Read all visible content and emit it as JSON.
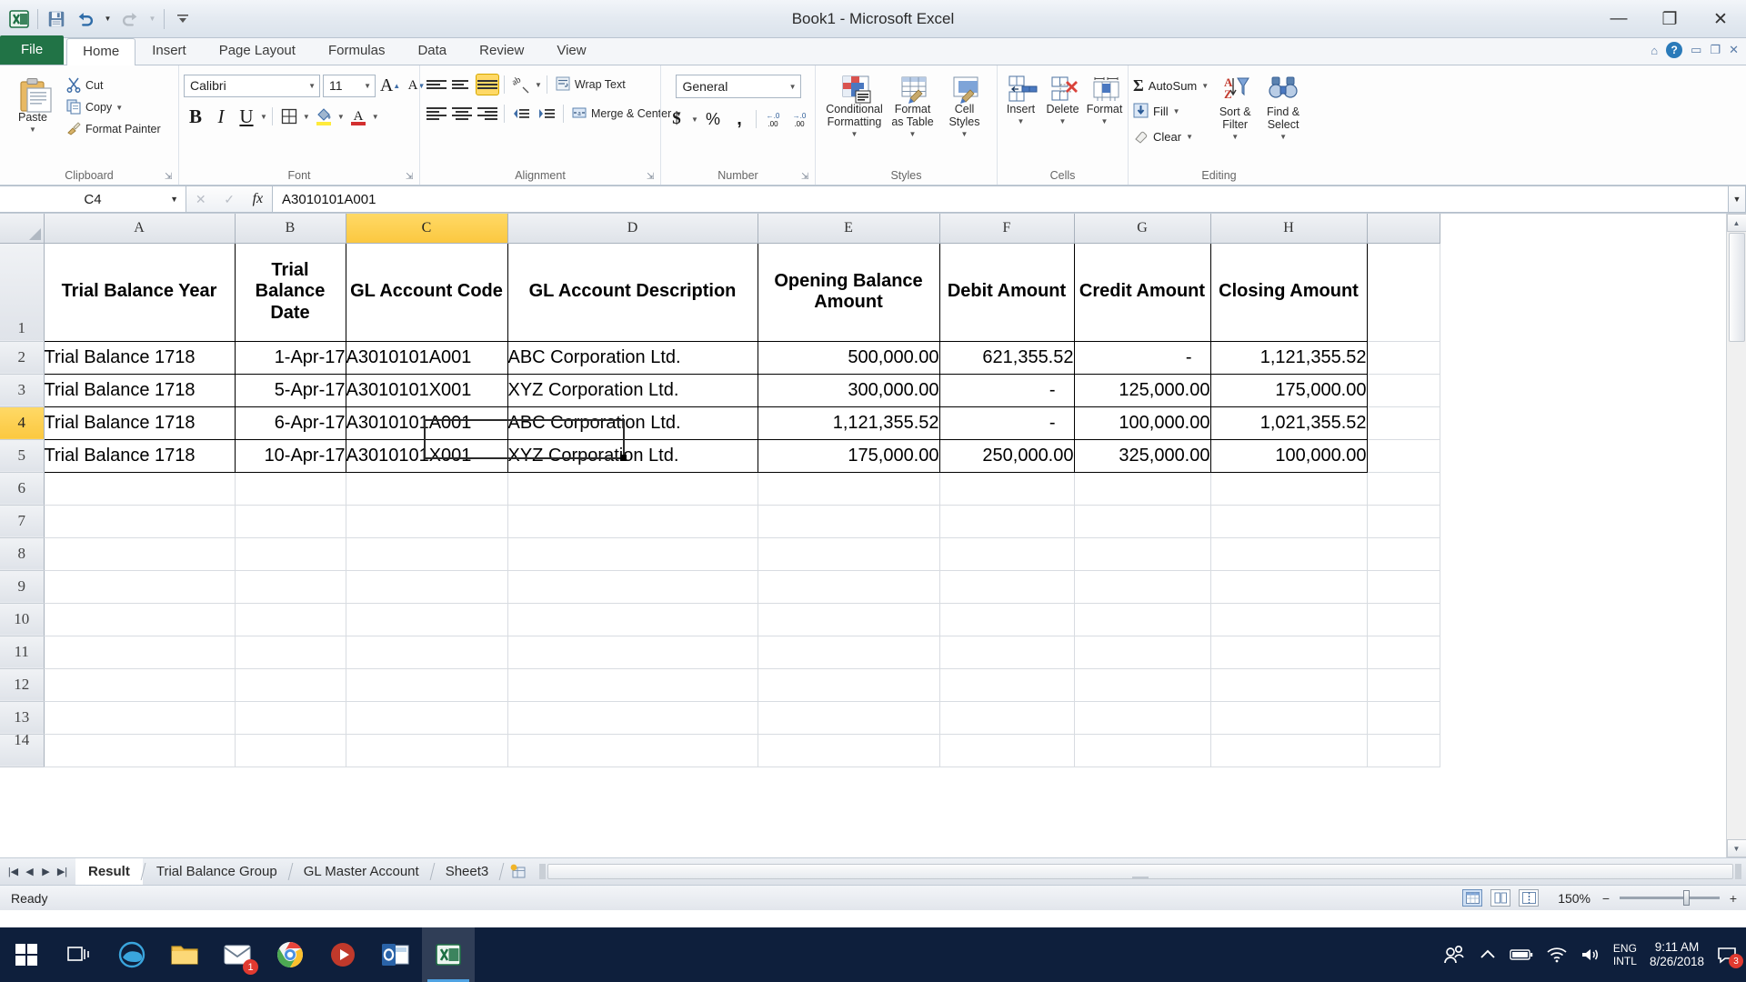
{
  "window": {
    "title": "Book1 - Microsoft Excel",
    "minimize": "—",
    "restore": "❐",
    "close": "✕"
  },
  "qat": {
    "excel_logo": "excel-logo",
    "save": "save-icon",
    "undo": "undo-icon",
    "redo": "redo-icon",
    "customize": "customize-qat-icon"
  },
  "ribbon": {
    "tabs": [
      {
        "label": "File",
        "active": false,
        "file": true
      },
      {
        "label": "Home",
        "active": true
      },
      {
        "label": "Insert",
        "active": false
      },
      {
        "label": "Page Layout",
        "active": false
      },
      {
        "label": "Formulas",
        "active": false
      },
      {
        "label": "Data",
        "active": false
      },
      {
        "label": "Review",
        "active": false
      },
      {
        "label": "View",
        "active": false
      }
    ],
    "groups": {
      "clipboard": {
        "label": "Clipboard",
        "paste": "Paste",
        "cut": "Cut",
        "copy": "Copy",
        "format_painter": "Format Painter"
      },
      "font": {
        "label": "Font",
        "font_name": "Calibri",
        "font_size": "11",
        "grow": "A",
        "shrink": "A",
        "bold": "B",
        "italic": "I",
        "underline": "U",
        "borders": "borders-icon",
        "fill_color": "fill-color-icon",
        "font_color": "A"
      },
      "alignment": {
        "label": "Alignment",
        "wrap_text": "Wrap Text",
        "merge_center": "Merge & Center",
        "orientation": "orientation-icon",
        "decrease_indent": "decrease-indent-icon",
        "increase_indent": "increase-indent-icon"
      },
      "number": {
        "label": "Number",
        "format": "General",
        "currency": "$",
        "percent": "%",
        "comma": ",",
        "increase_decimal": "increase-decimal-icon",
        "decrease_decimal": "decrease-decimal-icon"
      },
      "styles": {
        "label": "Styles",
        "conditional_formatting": "Conditional Formatting",
        "format_as_table": "Format as Table",
        "cell_styles": "Cell Styles"
      },
      "cells": {
        "label": "Cells",
        "insert": "Insert",
        "delete": "Delete",
        "format": "Format"
      },
      "editing": {
        "label": "Editing",
        "autosum": "AutoSum",
        "fill": "Fill",
        "clear": "Clear",
        "sort_filter": "Sort & Filter",
        "find_select": "Find & Select"
      }
    }
  },
  "formula_bar": {
    "name_box": "C4",
    "fx_label": "fx",
    "cancel": "✕",
    "enter": "✓",
    "value": "A3010101A001"
  },
  "sheet": {
    "columns": [
      "A",
      "B",
      "C",
      "D",
      "E",
      "F",
      "G",
      "H"
    ],
    "selected_column": "C",
    "selected_row": 4,
    "row_numbers": [
      1,
      2,
      3,
      4,
      5,
      6,
      7,
      8,
      9,
      10,
      11,
      12,
      13,
      14
    ],
    "headers": [
      "Trial Balance Year",
      "Trial Balance Date",
      "GL Account Code",
      "GL Account Description",
      "Opening Balance Amount",
      "Debit Amount",
      "Credit Amount",
      "Closing Amount"
    ],
    "rows": [
      [
        "Trial Balance 1718",
        "1-Apr-17",
        "A3010101A001",
        "ABC Corporation Ltd.",
        "500,000.00",
        "621,355.52",
        "-",
        "1,121,355.52"
      ],
      [
        "Trial Balance 1718",
        "5-Apr-17",
        "A3010101X001",
        "XYZ Corporation Ltd.",
        "300,000.00",
        "-",
        "125,000.00",
        "175,000.00"
      ],
      [
        "Trial Balance 1718",
        "6-Apr-17",
        "A3010101A001",
        "ABC Corporation Ltd.",
        "1,121,355.52",
        "-",
        "100,000.00",
        "1,021,355.52"
      ],
      [
        "Trial Balance 1718",
        "10-Apr-17",
        "A3010101X001",
        "XYZ Corporation Ltd.",
        "175,000.00",
        "250,000.00",
        "325,000.00",
        "100,000.00"
      ]
    ]
  },
  "sheet_tabs": {
    "first": "first-sheet-icon",
    "prev": "previous-sheet-icon",
    "next": "next-sheet-icon",
    "last": "last-sheet-icon",
    "items": [
      {
        "label": "Result",
        "active": true
      },
      {
        "label": "Trial Balance Group",
        "active": false
      },
      {
        "label": "GL Master Account",
        "active": false
      },
      {
        "label": "Sheet3",
        "active": false
      }
    ],
    "new_sheet": "insert-worksheet-icon"
  },
  "status_bar": {
    "state": "Ready",
    "view_normal": "normal-view-icon",
    "view_page_layout": "page-layout-view-icon",
    "view_page_break": "page-break-view-icon",
    "zoom": "150%",
    "zoom_out": "−",
    "zoom_in": "+"
  },
  "taskbar": {
    "start": "windows-start-icon",
    "task_view": "task-view-icon",
    "apps": [
      {
        "name": "edge-icon",
        "badge": ""
      },
      {
        "name": "file-explorer-icon",
        "badge": ""
      },
      {
        "name": "mail-icon",
        "badge": "1"
      },
      {
        "name": "chrome-icon",
        "badge": ""
      },
      {
        "name": "media-player-icon",
        "badge": ""
      },
      {
        "name": "outlook-icon",
        "badge": ""
      },
      {
        "name": "excel-icon",
        "badge": ""
      }
    ],
    "tray": {
      "people": "people-icon",
      "show_hidden": "show-hidden-icons-icon",
      "battery": "battery-icon",
      "network": "network-icon",
      "volume": "volume-icon",
      "lang_line1": "ENG",
      "lang_line2": "INTL",
      "time": "9:11 AM",
      "date": "8/26/2018",
      "notifications": "notifications-icon",
      "notification_count": "3"
    }
  }
}
